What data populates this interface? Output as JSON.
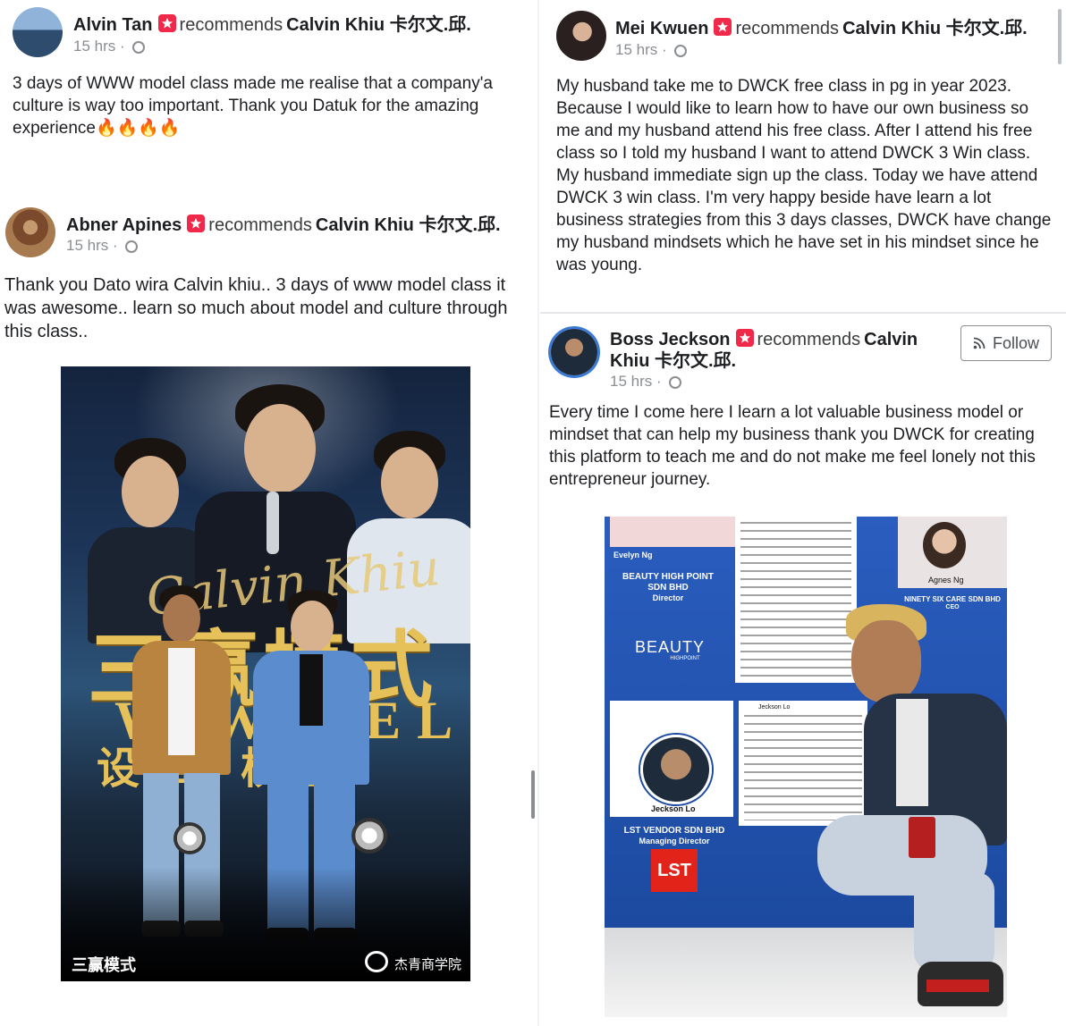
{
  "posts": [
    {
      "name": "Alvin Tan",
      "verb": "recommends",
      "target": "Calvin Khiu 卡尔文.邱.",
      "time": "15 hrs",
      "text": "3 days of WWW model class made me realise that a company'a culture is way too important. Thank you Datuk for the amazing experience🔥🔥🔥🔥"
    },
    {
      "name": "Abner Apines",
      "verb": "recommends",
      "target": "Calvin Khiu 卡尔文.邱.",
      "time": "15 hrs",
      "text": "Thank you Dato wira Calvin khiu.. 3 days of www model class it was awesome.. learn so much about model and culture through this class..",
      "poster": {
        "script": "Calvin Khiu",
        "title_cn": "三赢模式",
        "model_en": "W   W    DEL",
        "sub_cn": "设   的   棋盘",
        "footer_left": "三赢模式",
        "footer_right": "杰青商学院"
      }
    },
    {
      "name": "Mei Kwuen",
      "verb": "recommends",
      "target": "Calvin Khiu 卡尔文.邱.",
      "time": "15 hrs",
      "text": "My husband take me to DWCK free class in pg in year 2023. Because I would like to learn how to have our own business so me and my husband attend his free class. After I attend his free class so I told my husband I want to attend DWCK 3 Win class. My husband immediate sign up the class. Today we have attend DWCK 3 win class. I'm very happy beside have learn a lot business strategies from this 3 days classes, DWCK have change my husband mindsets which he have set in his mindset since he was young."
    },
    {
      "name": "Boss Jeckson",
      "verb": "recommends",
      "target_line1": "Calvin",
      "target_line2": "Khiu 卡尔文.邱.",
      "time": "15 hrs",
      "follow_label": "Follow",
      "text": "Every time I come here I learn a lot valuable business model or mindset that can help my business thank you DWCK for creating this platform to teach me and do not make me feel lonely not this entrepreneur journey.",
      "booth": {
        "card1_name": "Evelyn Ng",
        "card1_company": "BEAUTY HIGH POINT SDN BHD",
        "card1_role": "Director",
        "brand": "BEAUTY",
        "brand_sub": "HIGHPOINT",
        "card2_name": "Agnes Ng",
        "card2_company": "NINETY SIX CARE SDN BHD",
        "card2_role": "CEO",
        "card3_name": "Jeckson Lo",
        "card3_company": "LST VENDOR SDN BHD",
        "card3_role": "Managing Director",
        "logo": "LST",
        "note_name": "Jeckson Lo"
      }
    }
  ]
}
